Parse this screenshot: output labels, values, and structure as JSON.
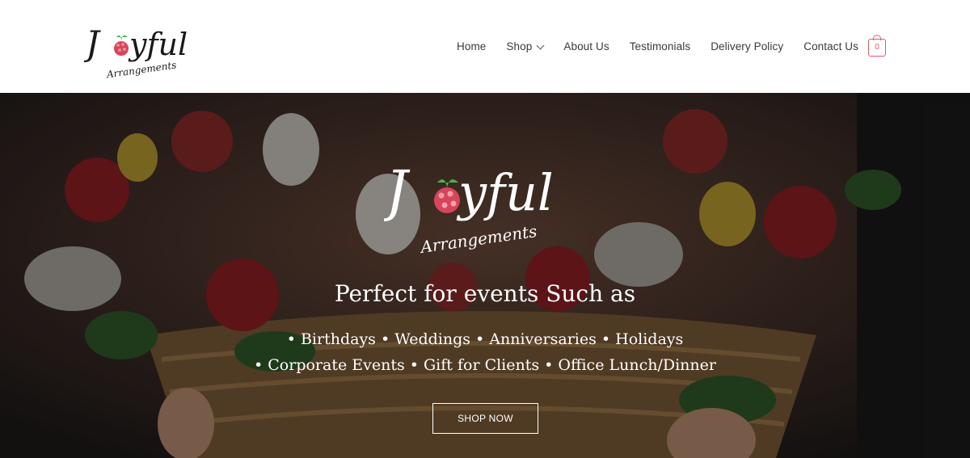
{
  "brand": {
    "name": "Joyful",
    "tagline": "Arrangements",
    "colors": {
      "accent": "#e05a6a",
      "berry": "#d6455a",
      "leaf": "#4caf50",
      "text": "#3a3a3a"
    }
  },
  "nav": {
    "items": [
      {
        "label": "Home"
      },
      {
        "label": "Shop",
        "has_dropdown": true
      },
      {
        "label": "About Us"
      },
      {
        "label": "Testimonials"
      },
      {
        "label": "Delivery Policy"
      },
      {
        "label": "Contact Us"
      }
    ],
    "cart_count": "0"
  },
  "hero": {
    "heading": "Perfect for events Such as",
    "line1": "• Birthdays • Weddings • Anniversaries • Holidays",
    "line2": "• Corporate Events • Gift for Clients • Office Lunch/Dinner",
    "button_label": "SHOP NOW"
  }
}
